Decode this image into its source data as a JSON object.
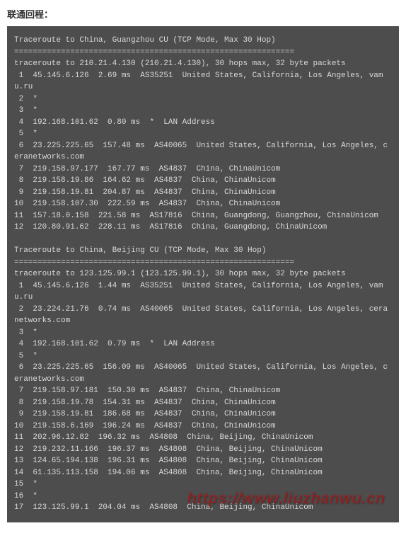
{
  "title": "联通回程：",
  "watermark": "https://www.liuzhanwu.cn",
  "trace1": {
    "header": "Traceroute to China, Guangzhou CU (TCP Mode, Max 30 Hop)",
    "divider": "============================================================",
    "cmd": "traceroute to 210.21.4.130 (210.21.4.130), 30 hops max, 32 byte packets",
    "hops": [
      " 1  45.145.6.126  2.69 ms  AS35251  United States, California, Los Angeles, vamu.ru",
      " 2  *",
      " 3  *",
      " 4  192.168.101.62  0.80 ms  *  LAN Address",
      " 5  *",
      " 6  23.225.225.65  157.48 ms  AS40065  United States, California, Los Angeles, ceranetworks.com",
      " 7  219.158.97.177  167.77 ms  AS4837  China, ChinaUnicom",
      " 8  219.158.19.86  164.62 ms  AS4837  China, ChinaUnicom",
      " 9  219.158.19.81  204.87 ms  AS4837  China, ChinaUnicom",
      "10  219.158.107.30  222.59 ms  AS4837  China, ChinaUnicom",
      "11  157.18.0.158  221.58 ms  AS17816  China, Guangdong, Guangzhou, ChinaUnicom",
      "12  120.80.91.62  228.11 ms  AS17816  China, Guangdong, ChinaUnicom"
    ]
  },
  "trace2": {
    "header": "Traceroute to China, Beijing CU (TCP Mode, Max 30 Hop)",
    "divider": "============================================================",
    "cmd": "traceroute to 123.125.99.1 (123.125.99.1), 30 hops max, 32 byte packets",
    "hops": [
      " 1  45.145.6.126  1.44 ms  AS35251  United States, California, Los Angeles, vamu.ru",
      " 2  23.224.21.76  0.74 ms  AS40065  United States, California, Los Angeles, ceranetworks.com",
      " 3  *",
      " 4  192.168.101.62  0.79 ms  *  LAN Address",
      " 5  *",
      " 6  23.225.225.65  156.09 ms  AS40065  United States, California, Los Angeles, ceranetworks.com",
      " 7  219.158.97.181  150.30 ms  AS4837  China, ChinaUnicom",
      " 8  219.158.19.78  154.31 ms  AS4837  China, ChinaUnicom",
      " 9  219.158.19.81  186.68 ms  AS4837  China, ChinaUnicom",
      "10  219.158.6.169  196.24 ms  AS4837  China, ChinaUnicom",
      "11  202.96.12.82  196.32 ms  AS4808  China, Beijing, ChinaUnicom",
      "12  219.232.11.166  196.37 ms  AS4808  China, Beijing, ChinaUnicom",
      "13  124.65.194.138  196.31 ms  AS4808  China, Beijing, ChinaUnicom",
      "14  61.135.113.158  194.06 ms  AS4808  China, Beijing, ChinaUnicom",
      "15  *",
      "16  *",
      "17  123.125.99.1  204.04 ms  AS4808  China, Beijing, ChinaUnicom"
    ]
  }
}
